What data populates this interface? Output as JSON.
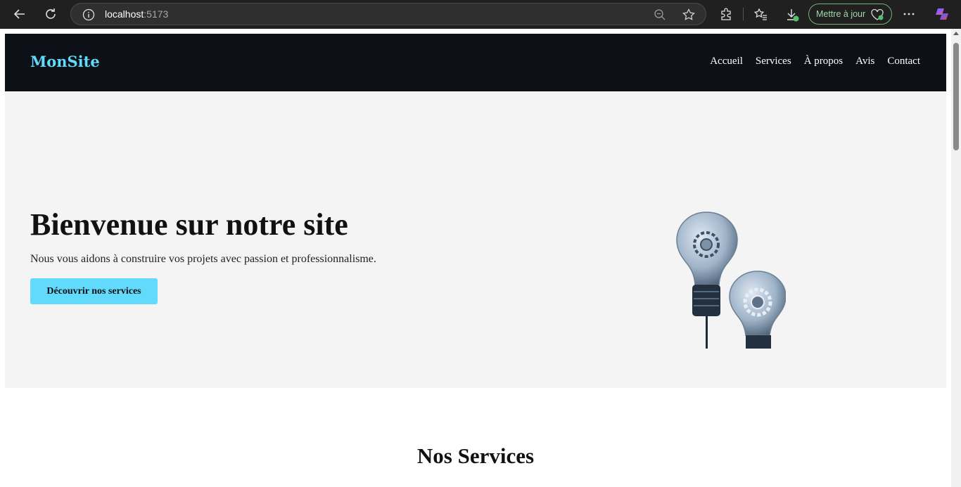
{
  "browser": {
    "url_host": "localhost",
    "url_port": ":5173",
    "update_label": "Mettre à jour",
    "icons": [
      "back-icon",
      "reload-icon",
      "info-icon",
      "zoom-out-icon",
      "favorite-star-icon",
      "extensions-icon",
      "favorites-icon",
      "downloads-icon",
      "more-icon",
      "copilot-icon"
    ]
  },
  "site": {
    "logo": "MonSite",
    "nav": [
      "Accueil",
      "Services",
      "À propos",
      "Avis",
      "Contact"
    ],
    "hero": {
      "title": "Bienvenue sur notre site",
      "subtitle": "Nous vous aidons à construire vos projets avec passion et professionnalisme.",
      "cta_label": "Découvrir nos services"
    },
    "services_title": "Nos Services"
  },
  "colors": {
    "accent": "#61dafb",
    "header_bg": "#0d1117",
    "hero_bg": "#f4f4f4"
  }
}
